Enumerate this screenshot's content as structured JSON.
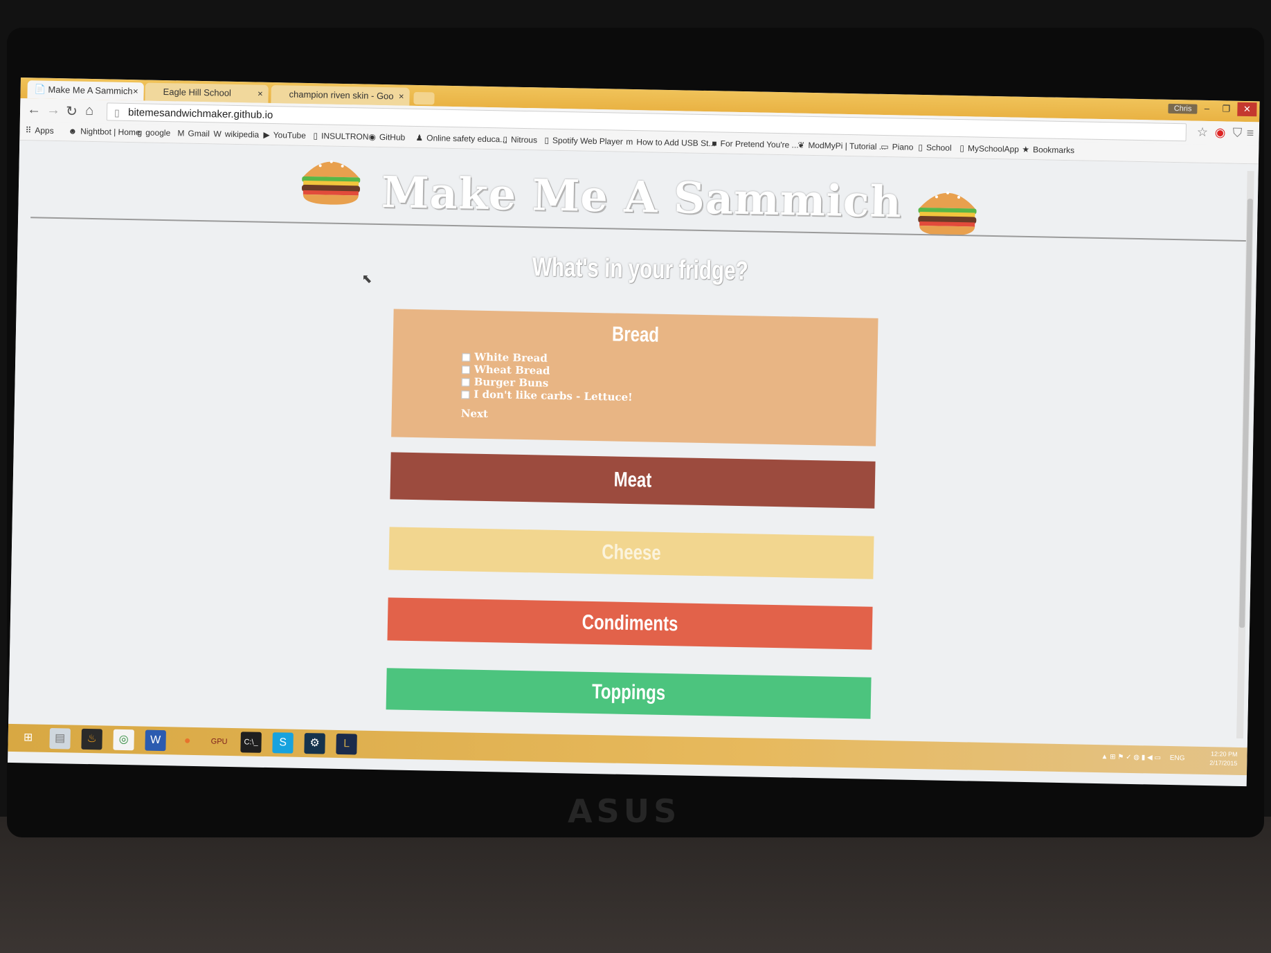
{
  "browser": {
    "tabs": [
      {
        "label": "Make Me A Sammich",
        "active": true
      },
      {
        "label": "Eagle Hill School",
        "active": false
      },
      {
        "label": "champion riven skin - Goo",
        "active": false
      }
    ],
    "user_badge": "Chris",
    "address": "bitemesandwichmaker.github.io",
    "bookmarks": [
      {
        "label": "Apps",
        "icon": "apps-grid-icon"
      },
      {
        "label": "Nightbot | Home",
        "icon": "nightbot-icon"
      },
      {
        "label": "google",
        "icon": "google-icon"
      },
      {
        "label": "Gmail",
        "icon": "gmail-icon"
      },
      {
        "label": "wikipedia",
        "icon": "wikipedia-icon"
      },
      {
        "label": "YouTube",
        "icon": "youtube-icon"
      },
      {
        "label": "INSULTRON",
        "icon": "page-icon"
      },
      {
        "label": "GitHub",
        "icon": "github-icon"
      },
      {
        "label": "Online safety educa...",
        "icon": "safety-icon"
      },
      {
        "label": "Nitrous",
        "icon": "page-icon"
      },
      {
        "label": "Spotify Web Player",
        "icon": "page-icon"
      },
      {
        "label": "How to Add USB St...",
        "icon": "m-icon"
      },
      {
        "label": "For Pretend You're ...",
        "icon": "square-icon"
      },
      {
        "label": "ModMyPi | Tutorial ...",
        "icon": "raspberry-icon"
      },
      {
        "label": "Piano",
        "icon": "folder-icon"
      },
      {
        "label": "School",
        "icon": "page-icon"
      },
      {
        "label": "MySchoolApp",
        "icon": "page-icon"
      },
      {
        "label": "Bookmarks",
        "icon": "star-icon"
      }
    ]
  },
  "page": {
    "title": "Make Me A Sammich",
    "subtitle": "What's in your fridge?",
    "bread": {
      "heading": "Bread",
      "options": [
        "White Bread",
        "Wheat Bread",
        "Burger Buns",
        "I don't like carbs - Lettuce!"
      ],
      "next_label": "Next"
    },
    "sections": {
      "meat": "Meat",
      "cheese": "Cheese",
      "condiments": "Condiments",
      "toppings": "Toppings"
    }
  },
  "taskbar": {
    "tray_lang": "ENG",
    "clock_time": "12:20 PM",
    "clock_date": "2/17/2015"
  },
  "hardware": {
    "brand": "ASUS"
  },
  "colors": {
    "bread": "#e8b584",
    "meat": "#9c4b3e",
    "cheese": "#f2d68f",
    "condiments": "#e2624a",
    "toppings": "#4cc47e",
    "chrome_frame": "#e9b243"
  }
}
